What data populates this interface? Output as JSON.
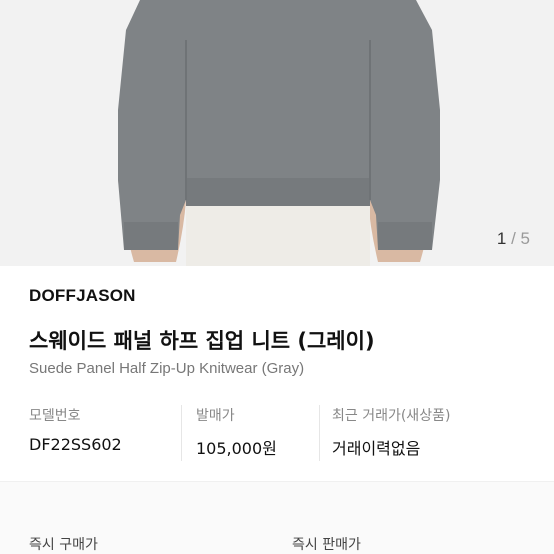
{
  "gallery": {
    "current": "1",
    "separator": "/",
    "total": "5"
  },
  "product": {
    "brand": "DOFFJASON",
    "name_ko": "스웨이드 패널 하프 집업 니트 (그레이)",
    "name_en": "Suede Panel Half Zip-Up Knitwear (Gray)"
  },
  "specs": [
    {
      "label": "모델번호",
      "value": "DF22SS602"
    },
    {
      "label": "발매가",
      "value": "105,000원"
    },
    {
      "label": "최근 거래가(새상품)",
      "value": "거래이력없음"
    }
  ],
  "trade": {
    "buy_label": "즉시 구매가",
    "sell_label": "즉시 판매가"
  },
  "colors": {
    "sweater": "#7f8386",
    "background": "#f2f2f2",
    "pants": "#eeece7"
  }
}
